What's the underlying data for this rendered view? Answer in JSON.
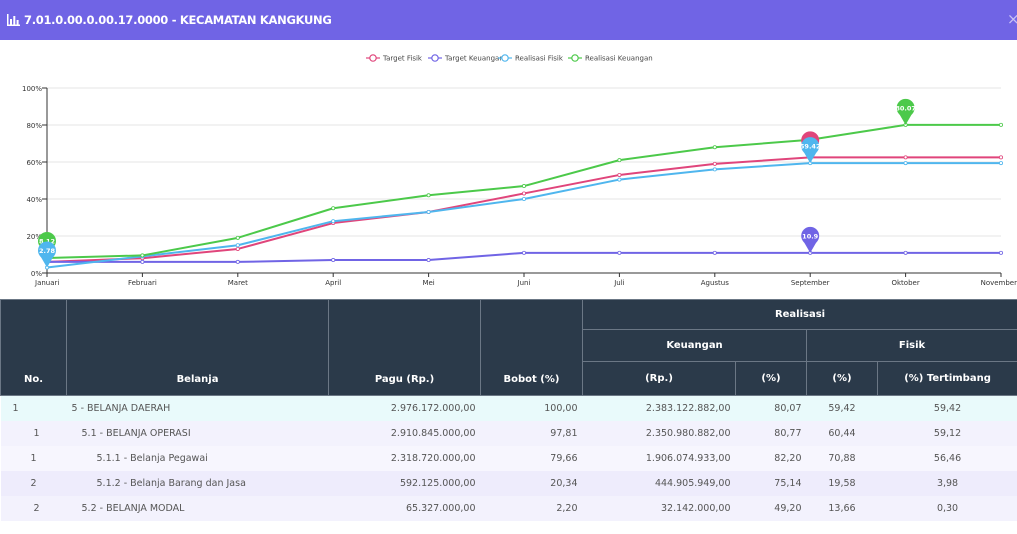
{
  "dialog": {
    "title": "7.01.0.00.0.00.17.0000 - KECAMATAN KANGKUNG",
    "close_symbol": "×"
  },
  "colors": {
    "header_bg": "#7064e5",
    "table_header_bg": "#2b3a4a",
    "target_fisik": "#e0457b",
    "target_keuangan": "#7064e5",
    "realisasi_fisik": "#4fb6ee",
    "realisasi_keuangan": "#4cc94a"
  },
  "chart_data": {
    "type": "line",
    "categories": [
      "Januari",
      "Februari",
      "Maret",
      "April",
      "Mei",
      "Juni",
      "Juli",
      "Agustus",
      "September",
      "Oktober",
      "November"
    ],
    "y_ticks": [
      "0%",
      "20%",
      "40%",
      "60%",
      "80%",
      "100%"
    ],
    "ylim": [
      0,
      100
    ],
    "grid": true,
    "legend_position": "top-center",
    "series": [
      {
        "name": "Target Fisik",
        "color": "#e0457b",
        "values": [
          6,
          8,
          13,
          27,
          33,
          43,
          53,
          59,
          62.5,
          62.5,
          62.5
        ]
      },
      {
        "name": "Target Keuangan",
        "color": "#7064e5",
        "values": [
          6,
          6,
          6,
          7,
          7,
          10.9,
          10.9,
          10.9,
          10.9,
          10.9,
          10.9
        ]
      },
      {
        "name": "Realisasi Fisik",
        "color": "#4fb6ee",
        "values": [
          3,
          9,
          15,
          28,
          33,
          40,
          50.5,
          56,
          59.42,
          59.42,
          59.42
        ]
      },
      {
        "name": "Realisasi Keuangan",
        "color": "#4cc94a",
        "values": [
          8.12,
          9.5,
          19,
          35,
          42,
          47,
          61,
          68,
          72,
          80.07,
          80.07
        ]
      }
    ],
    "markers": [
      {
        "series": "Realisasi Keuangan",
        "category": "Januari",
        "value": 8.12,
        "label": "8.12"
      },
      {
        "series": "Realisasi Fisik",
        "category": "Januari",
        "value": 3,
        "label": "2.78"
      },
      {
        "series": "Target Fisik",
        "category": "September",
        "value": 62.5,
        "label": ""
      },
      {
        "series": "Realisasi Fisik",
        "category": "September",
        "value": 59.42,
        "label": "59.42"
      },
      {
        "series": "Target Keuangan",
        "category": "September",
        "value": 10.9,
        "label": "10.9"
      },
      {
        "series": "Realisasi Keuangan",
        "category": "Oktober",
        "value": 80.07,
        "label": "80.07"
      }
    ]
  },
  "table": {
    "headers": {
      "no": "No.",
      "belanja": "Belanja",
      "pagu": "Pagu (Rp.)",
      "bobot": "Bobot (%)",
      "realisasi": "Realisasi",
      "keuangan": "Keuangan",
      "fisik": "Fisik",
      "rp": "(Rp.)",
      "pct_keu": "(%)",
      "pct_fisik": "(%)",
      "tertimbang": "(%) Tertimbang"
    },
    "rows": [
      {
        "no": "1",
        "belanja": "5 - BELANJA DAERAH",
        "pagu": "2.976.172.000,00",
        "bobot": "100,00",
        "rp": "2.383.122.882,00",
        "pct_keu": "80,07",
        "pct_fisik": "59,42",
        "tertimbang": "59,42"
      },
      {
        "no": "1",
        "belanja": "5.1 - BELANJA OPERASI",
        "pagu": "2.910.845.000,00",
        "bobot": "97,81",
        "rp": "2.350.980.882,00",
        "pct_keu": "80,77",
        "pct_fisik": "60,44",
        "tertimbang": "59,12"
      },
      {
        "no": "1",
        "belanja": "5.1.1 - Belanja Pegawai",
        "pagu": "2.318.720.000,00",
        "bobot": "79,66",
        "rp": "1.906.074.933,00",
        "pct_keu": "82,20",
        "pct_fisik": "70,88",
        "tertimbang": "56,46"
      },
      {
        "no": "2",
        "belanja": "5.1.2 - Belanja Barang dan Jasa",
        "pagu": "592.125.000,00",
        "bobot": "20,34",
        "rp": "444.905.949,00",
        "pct_keu": "75,14",
        "pct_fisik": "19,58",
        "tertimbang": "3,98"
      },
      {
        "no": "2",
        "belanja": "5.2 - BELANJA MODAL",
        "pagu": "65.327.000,00",
        "bobot": "2,20",
        "rp": "32.142.000,00",
        "pct_keu": "49,20",
        "pct_fisik": "13,66",
        "tertimbang": "0,30"
      }
    ]
  }
}
